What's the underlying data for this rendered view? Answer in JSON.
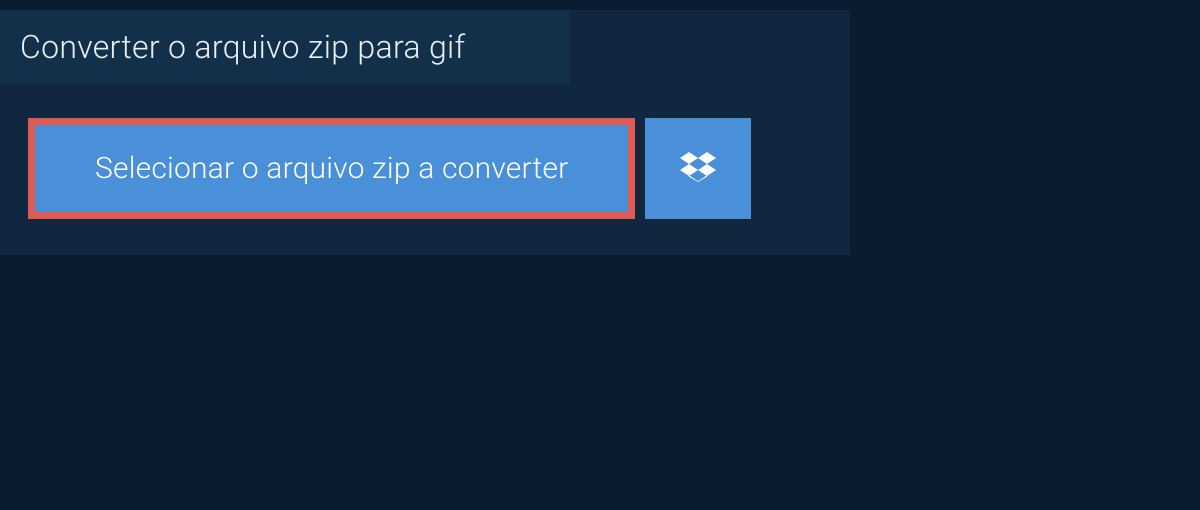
{
  "header": {
    "title": "Converter o arquivo zip para gif"
  },
  "actions": {
    "select_file_label": "Selecionar o arquivo zip a converter"
  }
}
